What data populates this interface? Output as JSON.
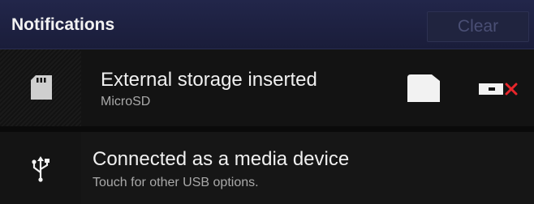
{
  "header": {
    "title": "Notifications",
    "clear_label": "Clear"
  },
  "notifications": [
    {
      "title": "External storage inserted",
      "subtitle": "MicroSD",
      "icon": "sd-card-icon",
      "actions": [
        "folder-icon",
        "unmount-icon"
      ]
    },
    {
      "title": "Connected as a media device",
      "subtitle": "Touch for other USB options.",
      "icon": "usb-icon"
    }
  ],
  "colors": {
    "header_bg": "#1a1d3a",
    "row_bg": "#131313",
    "accent_red": "#e8262b"
  }
}
